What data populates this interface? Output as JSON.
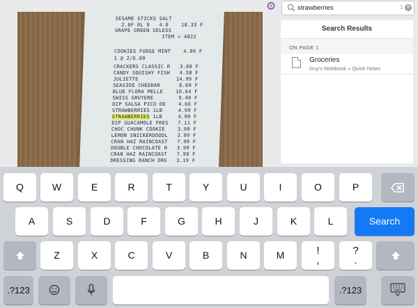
{
  "search": {
    "value": "strawberries",
    "count": "1"
  },
  "results": {
    "title": "Search Results",
    "section": "ON PAGE  1",
    "item": {
      "title": "Groceries",
      "subtitle": "Guy's Notebook » Quick Notes"
    }
  },
  "receipt": {
    "lines": [
      "SESAME STICKS SALT",
      "  2.0F 0L 9   4.0    10.33 F",
      "GRAPE GREEN SDLESS",
      "               ITEM = 4022",
      "",
      "COOKIES FUDGE MINT    4.99 F",
      "1 @ 2/6.00",
      "CRACKERS CLASSIC R   3.00 F",
      "CANDY SQUISHY FISH   4.58 F",
      "JULIETTE            14.99 F",
      "SEASIDE CHEDDAR      8.09 F",
      "BLUE FLORA MELLE    10.64 F",
      "SWISS GRUYERE        9.40 F",
      "DIP SALSA PICO DE    4.66 F",
      "STRAWBERRIES 1LB     4.99 F",
      "STRAWBERRIES 1LB     4.99 F",
      "DIP GUACAMOLE FRES   7.11 F",
      "CHOC CHUNK COOKIE    3.99 F",
      "LEMON SNICKERDOODL   3.99 F",
      "CRAN HAZ RAINCOAST   7.99 F",
      "DOUBLE CHOCOLATE R   3.99 F",
      "CRAN HAZ RAINCOAST   7.99 F",
      "DRESSING RANCH ORG   3.19 F"
    ],
    "highlight": "STRAWBERRIES"
  },
  "keyboard": {
    "row1": [
      "Q",
      "W",
      "E",
      "R",
      "T",
      "Y",
      "U",
      "I",
      "O",
      "P"
    ],
    "row2": [
      "A",
      "S",
      "D",
      "F",
      "G",
      "H",
      "J",
      "K",
      "L"
    ],
    "row3": [
      "Z",
      "X",
      "C",
      "V",
      "B",
      "N",
      "M"
    ],
    "row3_punct": [
      {
        "top": "!",
        "bottom": ","
      },
      {
        "top": "?",
        "bottom": "."
      }
    ],
    "search_label": "Search",
    "numbers_label": ".?123"
  }
}
